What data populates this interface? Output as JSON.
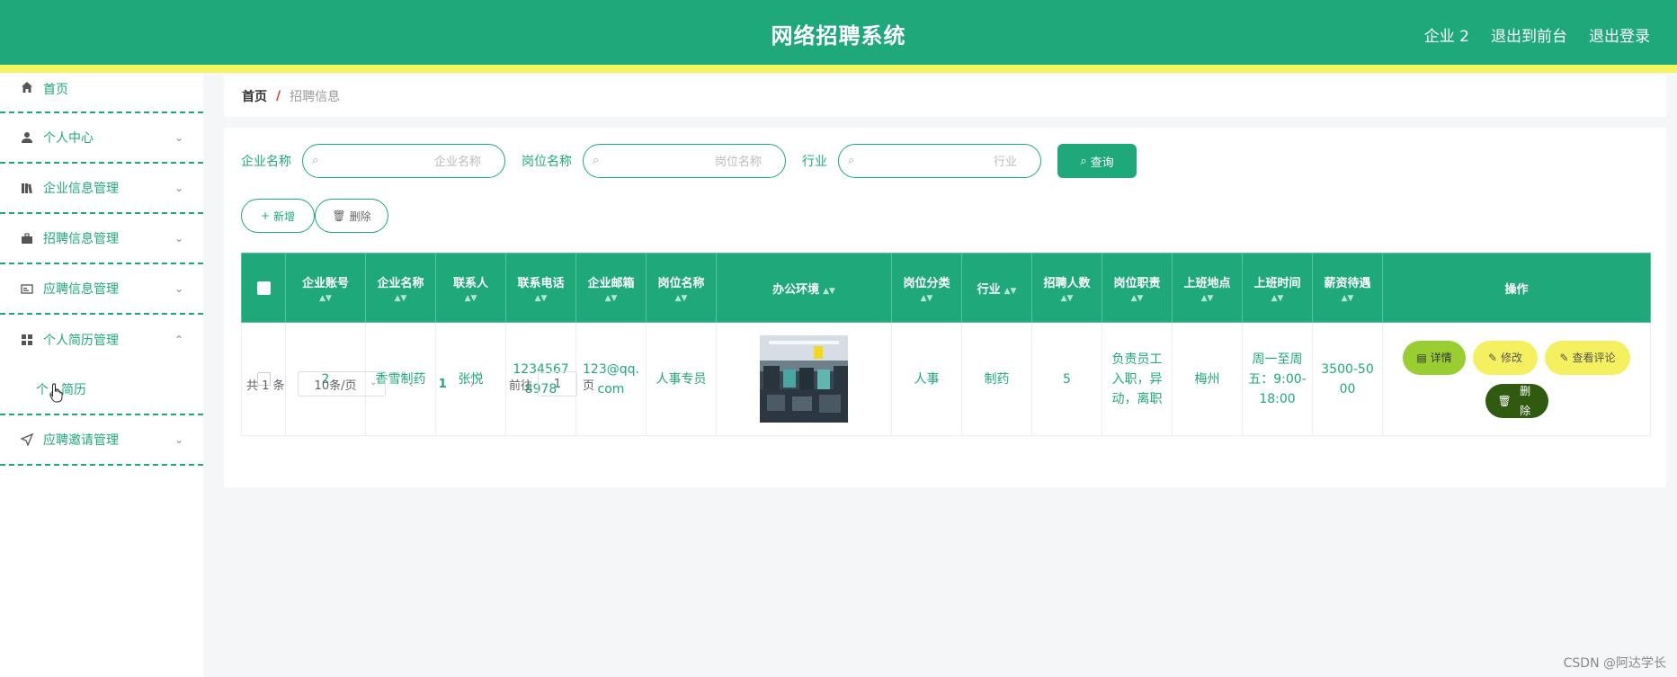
{
  "header": {
    "title": "网络招聘系统",
    "links": [
      "企业 2",
      "退出到前台",
      "退出登录"
    ]
  },
  "sidebar": {
    "items": [
      {
        "label": "首页",
        "icon": "home-icon",
        "has_chevron": false
      },
      {
        "label": "个人中心",
        "icon": "user-icon",
        "has_chevron": true
      },
      {
        "label": "企业信息管理",
        "icon": "books-icon",
        "has_chevron": true
      },
      {
        "label": "招聘信息管理",
        "icon": "briefcase-icon",
        "has_chevron": true
      },
      {
        "label": "应聘信息管理",
        "icon": "id-card-icon",
        "has_chevron": true
      },
      {
        "label": "个人简历管理",
        "icon": "grid-icon",
        "has_chevron": true,
        "expanded": true
      },
      {
        "label": "应聘邀请管理",
        "icon": "send-icon",
        "has_chevron": true
      }
    ],
    "sub_item": "个人简历"
  },
  "breadcrumb": {
    "home": "首页",
    "separator": "/",
    "current": "招聘信息"
  },
  "search": {
    "company_label": "企业名称",
    "company_placeholder": "企业名称",
    "position_label": "岗位名称",
    "position_placeholder": "岗位名称",
    "industry_label": "行业",
    "industry_placeholder": "行业",
    "query_button": "查询"
  },
  "actions": {
    "add": "新增",
    "delete": "删除"
  },
  "table": {
    "headers": [
      "企业账号",
      "企业名称",
      "联系人",
      "联系电话",
      "企业邮箱",
      "岗位名称",
      "办公环境",
      "岗位分类",
      "行业",
      "招聘人数",
      "岗位职责",
      "上班地点",
      "上班时间",
      "薪资待遇",
      "操作"
    ],
    "rows": [
      {
        "account": "2",
        "company": "香雪制药",
        "contact": "张悦",
        "phone": "12345678978",
        "email": "123@qq.com",
        "position": "人事专员",
        "category": "人事",
        "industry": "制药",
        "headcount": "5",
        "duty": "负责员工入职，异动，离职",
        "location": "梅州",
        "hours": "周一至周五：9:00-18:00",
        "salary": "3500-5000"
      }
    ],
    "row_buttons": {
      "detail": "详情",
      "edit": "修改",
      "review": "查看评论",
      "delete": "删除"
    }
  },
  "pagination": {
    "total": "共 1 条",
    "page_size": "10条/页",
    "current_page": "1",
    "goto_prefix": "前往",
    "goto_value": "1",
    "goto_suffix": "页"
  },
  "watermark": "CSDN @阿达学长",
  "colors": {
    "primary": "#1fa97b",
    "accent_yellow": "#f2f55f",
    "detail_btn": "#9acd32",
    "delete_btn": "#2f5a10"
  }
}
